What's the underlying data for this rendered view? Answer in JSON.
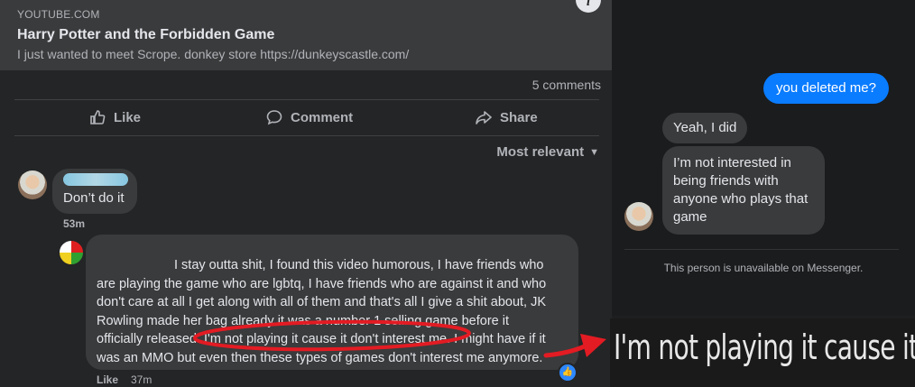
{
  "link_card": {
    "domain": "YOUTUBE.COM",
    "title": "Harry Potter and the Forbidden Game",
    "description": "I just wanted to meet Scrope. donkey store https://dunkeyscastle.com/"
  },
  "post": {
    "comments_count": "5 comments",
    "actions": {
      "like": "Like",
      "comment": "Comment",
      "share": "Share"
    },
    "sort_label": "Most relevant"
  },
  "comments": [
    {
      "text": "Don’t do it",
      "time": "53m"
    },
    {
      "lines": [
        "I stay outta shit, I found this video humorous, I have friends who",
        "are playing the game who are lgbtq, I have friends who are against it and who",
        "don't care at all I get along with all of them and that's all I give a shit about, JK",
        "Rowling made her bag already it was a number 1 selling game before it",
        "officially released. I'm not playing it cause it don't interest me. I might have if it",
        "was an MMO but even then these types of games don't interest me anymore."
      ],
      "like_label": "Like",
      "time": "37m"
    }
  ],
  "messenger": {
    "sent": "you deleted me?",
    "received_1": "Yeah, I did",
    "received_2": "I’m not interested in being friends with anyone who plays that game",
    "unavailable": "This person is unavailable on Messenger."
  },
  "zoom_caption": "I'm not playing it cause it don't interest me,",
  "colors": {
    "messenger_blue": "#0a7cff",
    "annotation_red": "#e31b23",
    "fb_card": "#3a3b3c"
  }
}
